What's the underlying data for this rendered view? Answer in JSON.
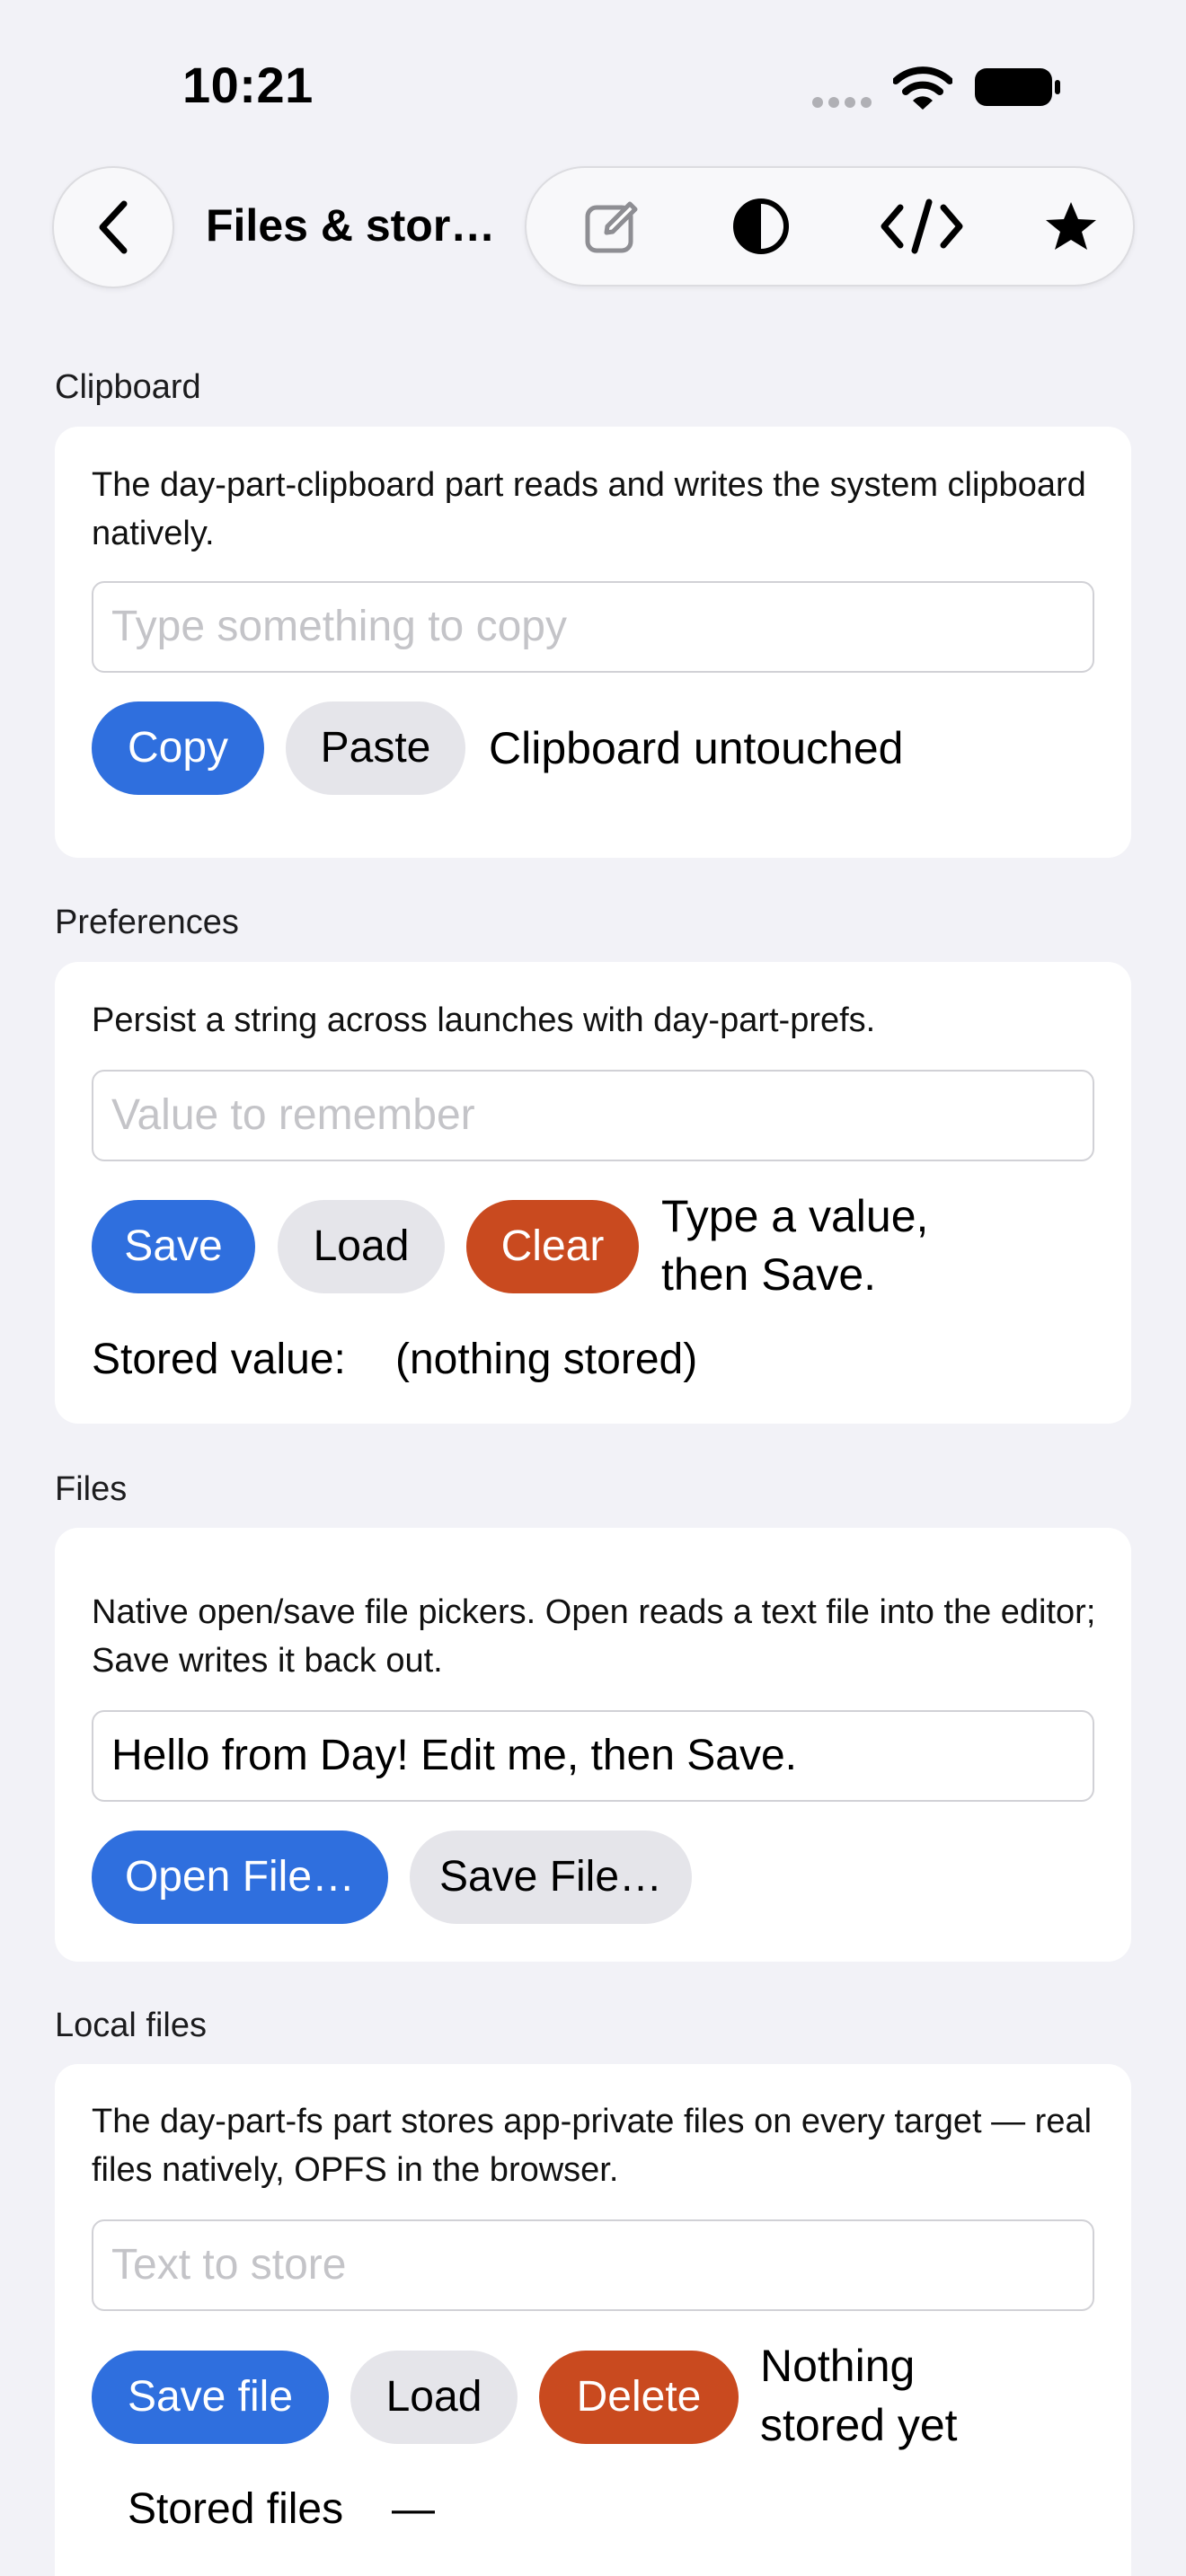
{
  "status_bar": {
    "time": "10:21"
  },
  "nav": {
    "title": "Files & stor…"
  },
  "sections": {
    "clipboard": {
      "label": "Clipboard",
      "description": "The day-part-clipboard part reads and writes the system clipboard natively.",
      "input_placeholder": "Type something to copy",
      "copy_label": "Copy",
      "paste_label": "Paste",
      "status": "Clipboard untouched"
    },
    "preferences": {
      "label": "Preferences",
      "description": "Persist a string across launches with day-part-prefs.",
      "input_placeholder": "Value to remember",
      "save_label": "Save",
      "load_label": "Load",
      "clear_label": "Clear",
      "status_line1": "Type a value,",
      "status_line2": "then Save.",
      "stored_label": "Stored value:",
      "stored_value": "(nothing stored)"
    },
    "files": {
      "label": "Files",
      "description": "Native open/save file pickers. Open reads a text file into the editor; Save writes it back out.",
      "editor_value": "Hello from Day! Edit me, then Save.",
      "open_label": "Open File…",
      "save_label": "Save File…"
    },
    "local_files": {
      "label": "Local files",
      "description": "The day-part-fs part stores app-private files on every target — real files natively, OPFS in the browser.",
      "input_placeholder": "Text to store",
      "save_label": "Save file",
      "load_label": "Load",
      "delete_label": "Delete",
      "status_line1": "Nothing",
      "status_line2": "stored yet",
      "stored_files_label": "Stored files",
      "stored_files_value": "—"
    }
  },
  "icons": [
    "back-chevron-icon",
    "edit-icon",
    "contrast-icon",
    "code-icon",
    "star-icon",
    "wifi-icon",
    "battery-icon"
  ],
  "colors": {
    "primary": "#2f6fde",
    "danger": "#c94a1f",
    "secondary": "#e5e5ea",
    "background": "#f2f2f7"
  }
}
